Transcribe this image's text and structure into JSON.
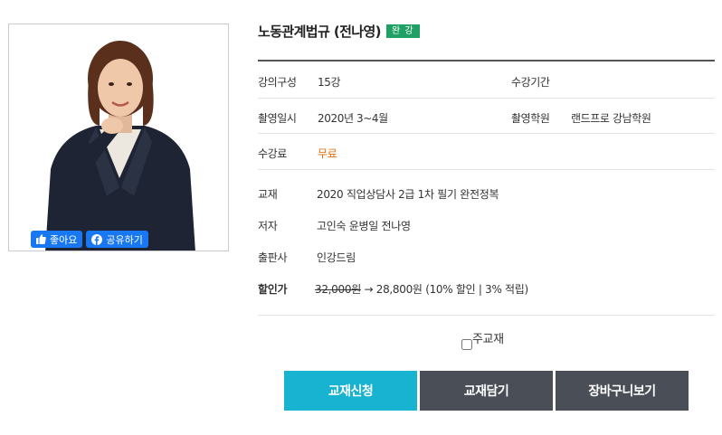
{
  "course": {
    "title": "노동관계법규 (전나영)",
    "badge": "완 강"
  },
  "social": {
    "like_label": "좋아요",
    "share_label": "공유하기",
    "brand_color": "#1877f2"
  },
  "info": {
    "lecture_count_label": "강의구성",
    "lecture_count_value": "15강",
    "period_label": "수강기간",
    "period_value": "",
    "filming_date_label": "촬영일시",
    "filming_date_value": "2020년 3~4월",
    "academy_label": "촬영학원",
    "academy_value": "랜드프로 강남학원",
    "fee_label": "수강료",
    "fee_value": "무료"
  },
  "textbook": {
    "book_label": "교재",
    "book_value": "2020 직업상담사 2급 1차 필기 완전정복",
    "author_label": "저자",
    "author_value": "고인숙 윤병일 전나영",
    "publisher_label": "출판사",
    "publisher_value": "인강드림",
    "price_label": "할인가",
    "original_price": "32,000원",
    "arrow": "→",
    "sale_price": "28,800원",
    "discount_note": "(10% 할인 | 3% 적립)"
  },
  "options": {
    "main_textbook_label": "주교재",
    "main_textbook_checked": false
  },
  "buttons": {
    "apply": "교재신청",
    "add": "교재담기",
    "cart": "장바구니보기"
  },
  "colors": {
    "accent_cyan": "#17b3d0",
    "dark_button": "#4a4e57",
    "badge_green": "#1fa064",
    "free_orange": "#e46c0a"
  }
}
